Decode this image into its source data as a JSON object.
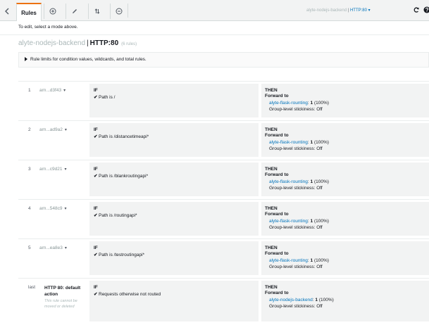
{
  "toolbar": {
    "tab_label": "Rules",
    "load_balancer": "alyte-nodejs-backend",
    "listener": "HTTP:80"
  },
  "hint": "To edit, select a mode above.",
  "heading": {
    "load_balancer": "alyte-nodejs-backend",
    "separator": "|",
    "listener": "HTTP:80",
    "rule_count": "(6 rules)"
  },
  "expander": {
    "label": "Rule limits for condition values, wildcards, and total rules."
  },
  "labels": {
    "if": "IF",
    "then": "THEN",
    "forward_to": "Forward to",
    "stickiness": "Group-level stickiness: Off"
  },
  "rules": [
    {
      "num": "1",
      "arn": "arn...d3f43",
      "condition": "Path is /",
      "target_group": "alyte-flask-rounting",
      "weight": "1",
      "percent": "(100%)"
    },
    {
      "num": "2",
      "arn": "arn...ad9a2",
      "condition": "Path is /distancetimeapi*",
      "target_group": "alyte-flask-rounting",
      "weight": "1",
      "percent": "(100%)"
    },
    {
      "num": "3",
      "arn": "arn...c9d21",
      "condition": "Path is /blankroutingapi*",
      "target_group": "alyte-flask-rounting",
      "weight": "1",
      "percent": "(100%)"
    },
    {
      "num": "4",
      "arn": "arn...548c9",
      "condition": "Path is /routingapi*",
      "target_group": "alyte-flask-rounting",
      "weight": "1",
      "percent": "(100%)"
    },
    {
      "num": "5",
      "arn": "arn...ea8e3",
      "condition": "Path is /testroutingapi*",
      "target_group": "alyte-flask-rounting",
      "weight": "1",
      "percent": "(100%)"
    }
  ],
  "default_rule": {
    "num": "last",
    "name": "HTTP 80: default action",
    "note": "This rule cannot be moved or deleted",
    "condition": "Requests otherwise not routed",
    "target_group": "alyte-nodejs-backend",
    "weight": "1",
    "percent": "(100%)"
  }
}
